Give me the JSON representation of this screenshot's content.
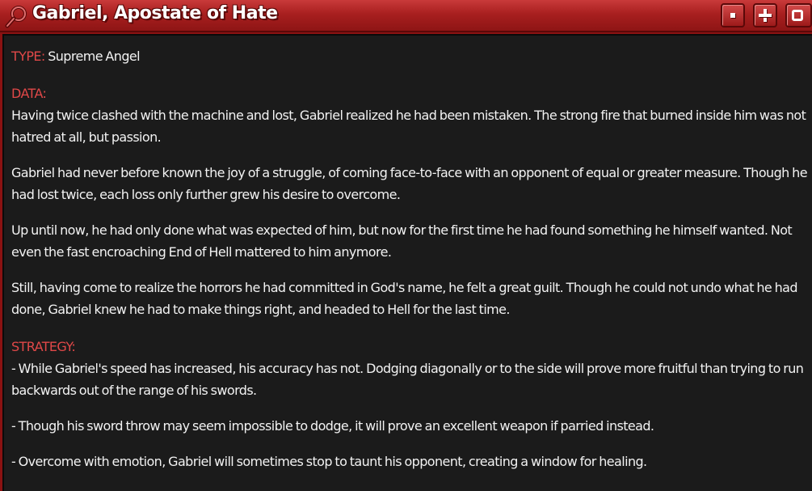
{
  "window": {
    "title": "Gabriel, Apostate of Hate",
    "icons": {
      "title_icon": "magnifier-icon",
      "minimize": "minimize-icon",
      "maximize": "plus-icon",
      "close": "close-icon"
    }
  },
  "entry": {
    "type_label": "TYPE:",
    "type_value": " Supreme Angel",
    "data_label": "DATA:",
    "data_paragraphs": [
      "Having twice clashed with the machine and lost, Gabriel realized he had been mistaken. The strong fire that burned inside him was not hatred at all, but passion.",
      "Gabriel had never before known the joy of a struggle, of coming face-to-face with an opponent of equal or greater measure. Though he had lost twice, each loss only further grew his desire to overcome.",
      "Up until now, he had only done what was expected of him, but now for the first time he had found something he himself wanted. Not even the fast encroaching End of Hell mattered to him anymore.",
      "Still, having come to realize the horrors he had committed in God's name, he felt a great guilt. Though he could not undo what he had done, Gabriel knew he had to make things right, and headed to Hell for the last time."
    ],
    "strategy_label": "STRATEGY:",
    "strategy_items": [
      "- While Gabriel's speed has increased, his accuracy has not. Dodging diagonally or to the side will prove more fruitful than trying to run backwards out of the range of his swords.",
      "- Though his sword throw may seem impossible to dodge, it will prove an excellent weapon if parried instead.",
      "- Overcome with emotion, Gabriel will sometimes stop to taunt his opponent, creating a window for healing."
    ]
  },
  "colors": {
    "titlebar": "#a81f1f",
    "label": "#e04848",
    "text": "#f2f2f2",
    "background": "#1b1b1b"
  }
}
